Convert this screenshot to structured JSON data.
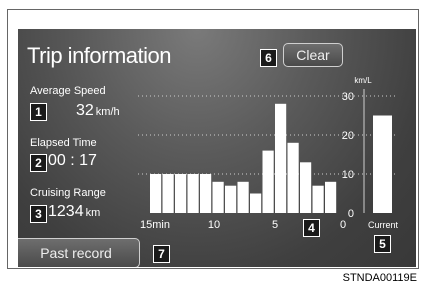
{
  "screen": {
    "title": "Trip information",
    "clear_button": "Clear",
    "past_record_button": "Past record",
    "average_speed": {
      "label": "Average Speed",
      "value": "32",
      "unit": "km/h"
    },
    "elapsed_time": {
      "label": "Elapsed Time",
      "value": "00 : 17"
    },
    "cruising_range": {
      "label": "Cruising Range",
      "value": "1234",
      "unit": "km"
    }
  },
  "callouts": [
    "1",
    "2",
    "3",
    "4",
    "5",
    "6",
    "7"
  ],
  "caption": "STNDA00119E",
  "chart_data": {
    "type": "bar",
    "unit_label": "km/L",
    "y_ticks": [
      "30",
      "20",
      "10",
      "0"
    ],
    "x_ticks": [
      "15min",
      "10",
      "5",
      "0"
    ],
    "current_label": "Current",
    "ylim": [
      0,
      30
    ],
    "values": [
      10,
      10,
      10,
      10,
      10,
      8,
      7,
      8,
      5,
      16,
      28,
      18,
      13,
      7,
      8
    ],
    "current_value": 25,
    "bar_color": "#ffffff"
  }
}
